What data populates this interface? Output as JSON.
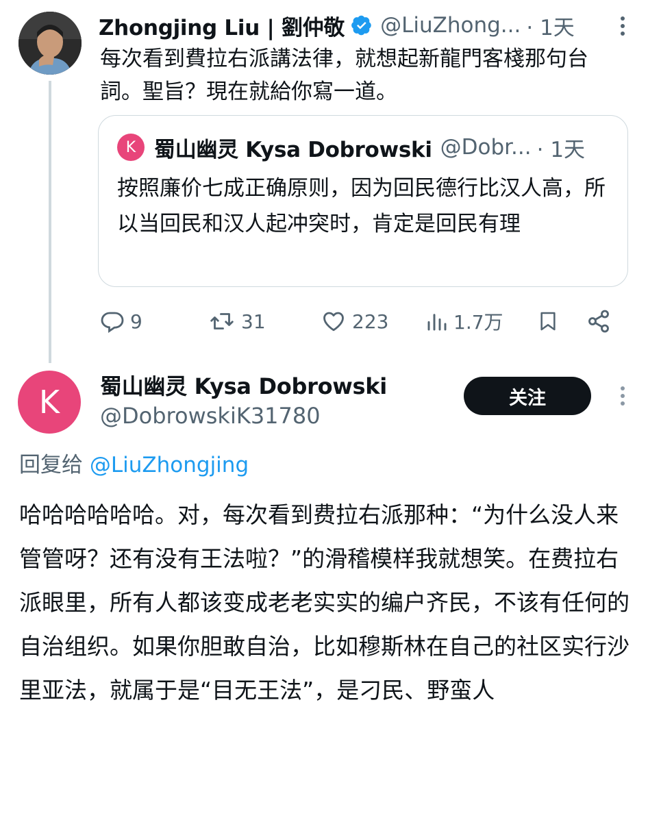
{
  "parent_tweet": {
    "avatar_alt": "Zhongjing Liu avatar",
    "display_name": "Zhongjing Liu | 劉仲敬",
    "verified": true,
    "handle": "@LiuZhong...",
    "time": "· 1天",
    "text": "每次看到費拉右派講法律，就想起新龍門客棧那句台詞。聖旨？現在就給你寫一道。",
    "quote": {
      "avatar_letter": "K",
      "display_name": "蜀山幽灵 Kysa Dobrowski",
      "handle": "@Dobr...",
      "time": "· 1天",
      "text": "按照廉价七成正确原则，因为回民德行比汉人高，所以当回民和汉人起冲突时，肯定是回民有理"
    },
    "actions": {
      "replies": "9",
      "retweets": "31",
      "likes": "223",
      "views": "1.7万"
    }
  },
  "reply_tweet": {
    "avatar_letter": "K",
    "display_name": "蜀山幽灵 Kysa Dobrowski",
    "handle": "@DobrowskiK31780",
    "follow_label": "关注",
    "reply_prefix": "回复给",
    "reply_mention": "@LiuZhongjing",
    "text": "哈哈哈哈哈哈。对，每次看到费拉右派那种：“为什么没人来管管呀？还有没有王法啦？”的滑稽模样我就想笑。在费拉右派眼里，所有人都该变成老老实实的编户齐民，不该有任何的自治组织。如果你胆敢自治，比如穆斯林在自己的社区实行沙里亚法，就属于是“目无王法”，是刁民、野蛮人"
  },
  "colors": {
    "accent": "#1d9bf0",
    "secondary_text": "#536471",
    "avatar_pink": "#e8457a",
    "follow_button": "#0f1419"
  }
}
